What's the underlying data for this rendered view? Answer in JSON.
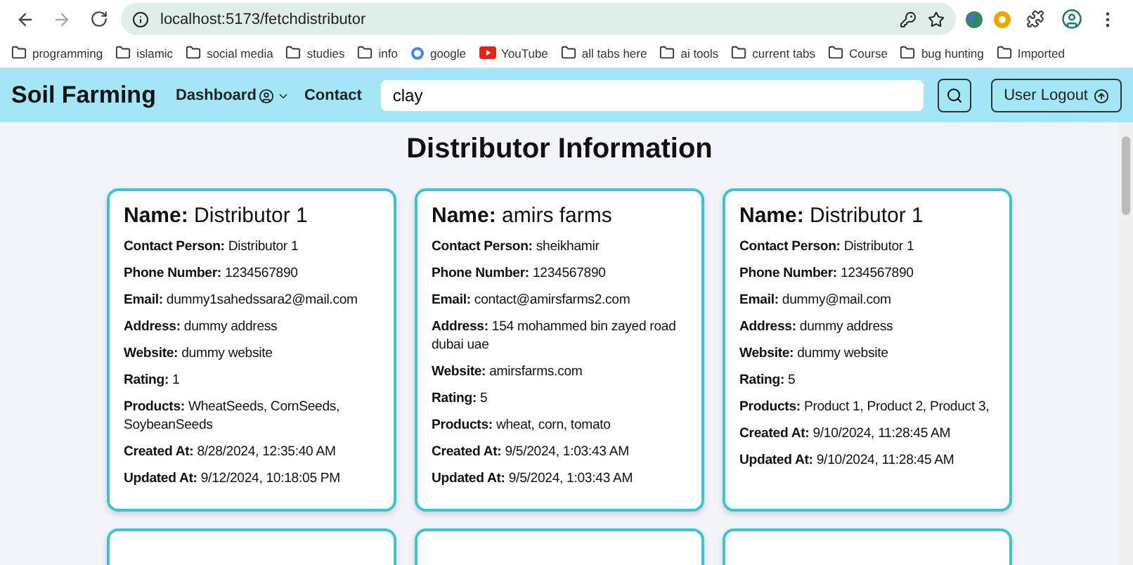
{
  "browser": {
    "url": "localhost:5173/fetchdistributor",
    "bookmarks": [
      {
        "label": "programming",
        "kind": "folder"
      },
      {
        "label": "islamic",
        "kind": "folder"
      },
      {
        "label": "social media",
        "kind": "folder"
      },
      {
        "label": "studies",
        "kind": "folder"
      },
      {
        "label": "info",
        "kind": "folder"
      },
      {
        "label": "google",
        "kind": "google"
      },
      {
        "label": "YouTube",
        "kind": "youtube"
      },
      {
        "label": "all tabs here",
        "kind": "folder"
      },
      {
        "label": "ai tools",
        "kind": "folder"
      },
      {
        "label": "current tabs",
        "kind": "folder"
      },
      {
        "label": "Course",
        "kind": "folder"
      },
      {
        "label": "bug hunting",
        "kind": "folder"
      },
      {
        "label": "Imported",
        "kind": "folder"
      }
    ]
  },
  "navbar": {
    "brand": "Soil Farming",
    "links": [
      {
        "label": "Dashboard",
        "kind": "dropdown"
      },
      {
        "label": "Contact",
        "kind": "link"
      }
    ],
    "search": {
      "value": "clay"
    },
    "logout": "User Logout"
  },
  "heading": "Distributor Information",
  "cards": [
    {
      "name": "**Name:** Distributor 1",
      "fields": [
        "**Contact Person:** Distributor 1",
        "**Phone Number:** 1234567890",
        "**Email:** dummy1sahedssara2@mail.com",
        "**Address:** dummy address",
        "**Website:** dummy website",
        "**Rating:** 1",
        "**Products:** WheatSeeds, CornSeeds, SoybeanSeeds",
        "**Created At:** 8/28/2024, 12:35:40 AM",
        "**Updated At:** 9/12/2024, 10:18:05 PM"
      ]
    },
    {
      "name": "**Name:** amirs farms",
      "fields": [
        "**Contact Person:** sheikhamir",
        "**Phone Number:** 1234567890",
        "**Email:** contact@amirsfarms2.com",
        "**Address:** 154 mohammed bin zayed road dubai uae",
        "**Website:** amirsfarms.com",
        "**Rating:** 5",
        "**Products:** wheat, corn, tomato",
        "**Created At:** 9/5/2024, 1:03:43 AM",
        "**Updated At:** 9/5/2024, 1:03:43 AM"
      ]
    },
    {
      "name": "**Name:** Distributor 1",
      "fields": [
        "**Contact Person:** Distributor 1",
        "**Phone Number:** 1234567890",
        "**Email:** dummy@mail.com",
        "**Address:** dummy address",
        "**Website:** dummy website",
        "**Rating:** 5",
        "**Products:** Product 1, Product 2, Product 3,",
        "**Created At:** 9/10/2024, 11:28:45 AM",
        "**Updated At:** 9/10/2024, 11:28:45 AM"
      ]
    }
  ],
  "next_row_cards": [
    {
      "clipped": true
    },
    {
      "clipped": true
    },
    {
      "clipped": true
    }
  ]
}
